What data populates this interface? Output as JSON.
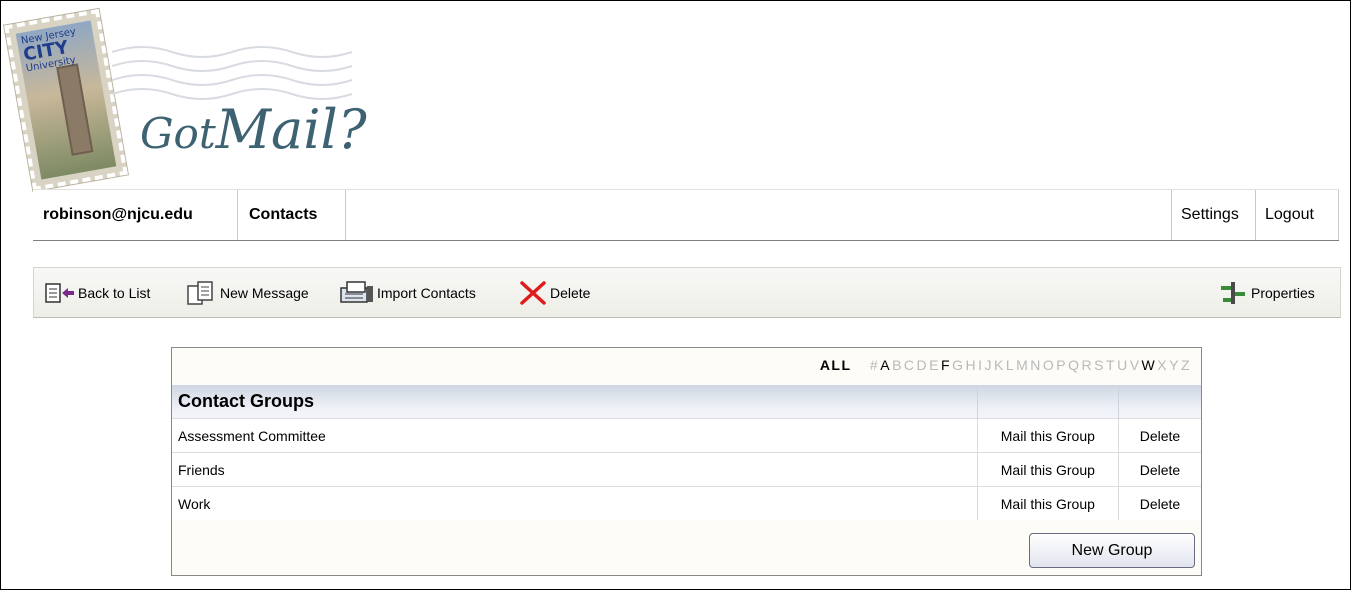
{
  "logo": {
    "stamp_line1": "New Jersey",
    "stamp_line2": "CITY",
    "stamp_line3": "University",
    "got": "Got",
    "mail": "Mail?"
  },
  "nav": {
    "user": "robinson@njcu.edu",
    "contacts": "Contacts",
    "settings": "Settings",
    "logout": "Logout"
  },
  "toolbar": {
    "back": "Back to List",
    "new_message": "New Message",
    "import_contacts": "Import Contacts",
    "delete": "Delete",
    "properties": "Properties"
  },
  "alphabet": {
    "all": "ALL",
    "letters": [
      "#",
      "A",
      "B",
      "C",
      "D",
      "E",
      "F",
      "G",
      "H",
      "I",
      "J",
      "K",
      "L",
      "M",
      "N",
      "O",
      "P",
      "Q",
      "R",
      "S",
      "T",
      "U",
      "V",
      "W",
      "X",
      "Y",
      "Z"
    ],
    "active": [
      "A",
      "F",
      "W"
    ]
  },
  "groups": {
    "header": "Contact Groups",
    "rows": [
      {
        "name": "Assessment Committee",
        "mail": "Mail this Group",
        "delete": "Delete"
      },
      {
        "name": "Friends",
        "mail": "Mail this Group",
        "delete": "Delete"
      },
      {
        "name": "Work",
        "mail": "Mail this Group",
        "delete": "Delete"
      }
    ],
    "new_group_label": "New Group"
  }
}
